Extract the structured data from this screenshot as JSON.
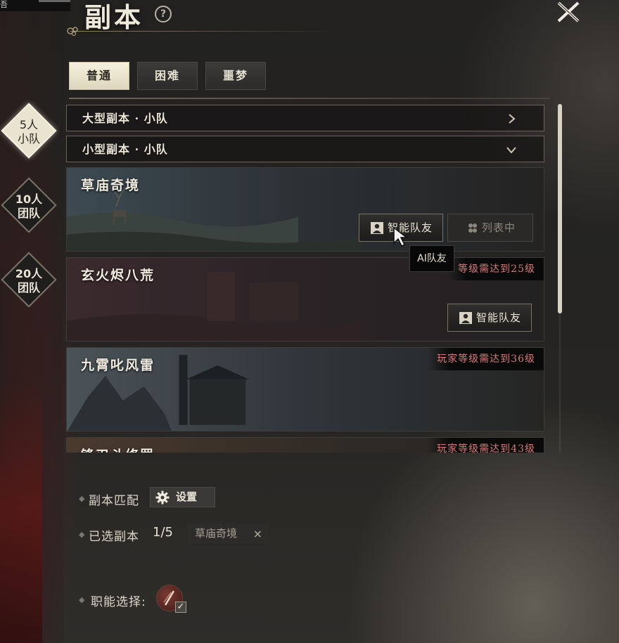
{
  "header": {
    "title": "副本",
    "help_glyph": "?",
    "top_left_fragment": "吾"
  },
  "difficulty_tabs": [
    {
      "label": "普通",
      "active": true
    },
    {
      "label": "困难",
      "active": false
    },
    {
      "label": "噩梦",
      "active": false
    }
  ],
  "team_sizes": [
    {
      "line1": "5人",
      "line2": "小队",
      "active": true
    },
    {
      "line1": "10人",
      "line2": "团队",
      "active": false
    },
    {
      "line1": "20人",
      "line2": "团队",
      "active": false
    }
  ],
  "groups": [
    {
      "label": "大型副本 · 小队",
      "state": "collapsed"
    },
    {
      "label": "小型副本 · 小队",
      "state": "expanded"
    }
  ],
  "dungeons": [
    {
      "name": "草庙奇境",
      "requirement": "",
      "primary_button": "智能队友",
      "secondary_button": "列表中"
    },
    {
      "name": "玄火烬八荒",
      "requirement": "等级需达到25级",
      "primary_button": "智能队友"
    },
    {
      "name": "九霄叱风雷",
      "requirement": "玩家等级需达到36级"
    },
    {
      "name": "锋刃斗修罗",
      "requirement": "玩家等级需达到43级"
    }
  ],
  "tooltip": {
    "text": "AI队友"
  },
  "matching": {
    "label": "副本匹配",
    "settings_button": "设置"
  },
  "selected": {
    "label": "已选副本",
    "count": "1/5",
    "chip": "草庙奇境",
    "chip_remove": "×"
  },
  "role": {
    "label": "职能选择:",
    "checked": true,
    "check_glyph": "✓"
  },
  "colors": {
    "accent_gold": "#c9bf9f",
    "requirement_red": "#d77a78",
    "active_tab_bg": "#f6f1de"
  },
  "scroll": {
    "visible_fraction": 0.6
  }
}
